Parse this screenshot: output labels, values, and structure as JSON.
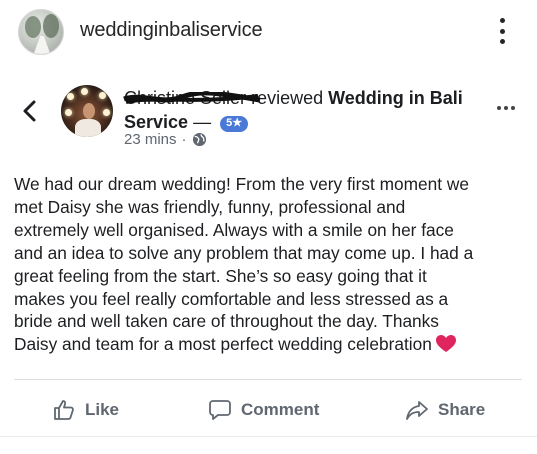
{
  "header": {
    "username": "weddinginbaliservice"
  },
  "review": {
    "reviewer_name": "Christine Seiler",
    "reviewed_word": "reviewed",
    "page_name": "Wedding in Bali Service",
    "separator": "—",
    "rating": "5★",
    "time": "23 mins",
    "dot": "·",
    "text_lines": [
      "We had our dream wedding! From the very first moment we",
      "met Daisy she was friendly, funny, professional and",
      "extremely well organised. Always with a smile on her face",
      "and an idea to solve any problem that may come up. I had a",
      "great feeling from the start. She’s so easy going that it",
      "makes you feel really comfortable and less stressed as a",
      "bride and well taken care of throughout the day. Thanks",
      "Daisy and team for a most perfect wedding celebration"
    ]
  },
  "actions": {
    "like": "Like",
    "comment": "Comment",
    "share": "Share"
  },
  "colors": {
    "badge": "#4b79d8",
    "heart": "#e0245e",
    "action_text": "#606770"
  }
}
